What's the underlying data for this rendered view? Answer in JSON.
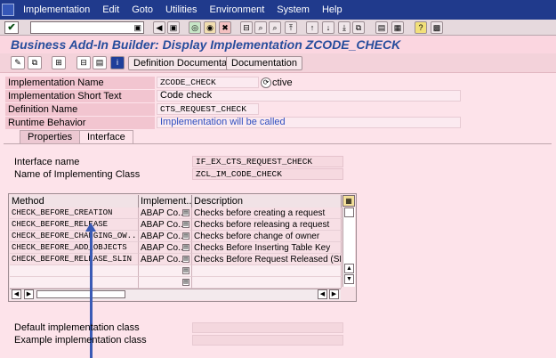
{
  "menubar": {
    "items": [
      "Implementation",
      "Edit",
      "Goto",
      "Utilities",
      "Environment",
      "System",
      "Help"
    ]
  },
  "toolbar": {
    "ok_icon": "checkmark-icon",
    "command_field_value": ""
  },
  "title": "Business Add-In Builder: Display Implementation ZCODE_CHECK",
  "app_toolbar": {
    "definition_documentation_label": "Definition Documenta",
    "documentation_label": "Documentation"
  },
  "header": {
    "rows": [
      {
        "label": "Implementation Name",
        "value": "ZCODE_CHECK",
        "status": "ctive"
      },
      {
        "label": "Implementation Short Text",
        "value": "Code check"
      },
      {
        "label": "Definition Name",
        "value": "CTS_REQUEST_CHECK"
      },
      {
        "label": "Runtime Behavior",
        "value": "Implementation will be called",
        "value_color": "#3050c0"
      }
    ]
  },
  "tabs": [
    {
      "label": "Properties",
      "active": false
    },
    {
      "label": "Interface",
      "active": true
    }
  ],
  "interface": {
    "interface_name_label": "Interface name",
    "interface_name_value": "IF_EX_CTS_REQUEST_CHECK",
    "class_label": "Name of Implementing Class",
    "class_value": "ZCL_IM_CODE_CHECK"
  },
  "table": {
    "columns": [
      "Method",
      "Implement...",
      "Description"
    ],
    "rows": [
      {
        "method": "CHECK_BEFORE_CREATION",
        "impl": "ABAP Co...",
        "desc": "Checks before creating a request"
      },
      {
        "method": "CHECK_BEFORE_RELEASE",
        "impl": "ABAP Co...",
        "desc": "Checks before releasing a request"
      },
      {
        "method": "CHECK_BEFORE_CHANGING_OW...",
        "impl": "ABAP Co...",
        "desc": "Checks before change of owner"
      },
      {
        "method": "CHECK_BEFORE_ADD_OBJECTS",
        "impl": "ABAP Co...",
        "desc": "Checks Before Inserting Table Key"
      },
      {
        "method": "CHECK_BEFORE_RELEASE_SLIN",
        "impl": "ABAP Co...",
        "desc": "Checks Before Request Released (SLIN"
      },
      {
        "method": "",
        "impl": "",
        "desc": ""
      },
      {
        "method": "",
        "impl": "",
        "desc": ""
      }
    ]
  },
  "bottom": {
    "default_class_label": "Default implementation class",
    "default_class_value": "",
    "example_class_label": "Example implementation class",
    "example_class_value": ""
  },
  "colors": {
    "menubar": "#203a8c",
    "title": "#274d9c",
    "background": "#fde3ea",
    "arrow": "#3a5ab5"
  }
}
